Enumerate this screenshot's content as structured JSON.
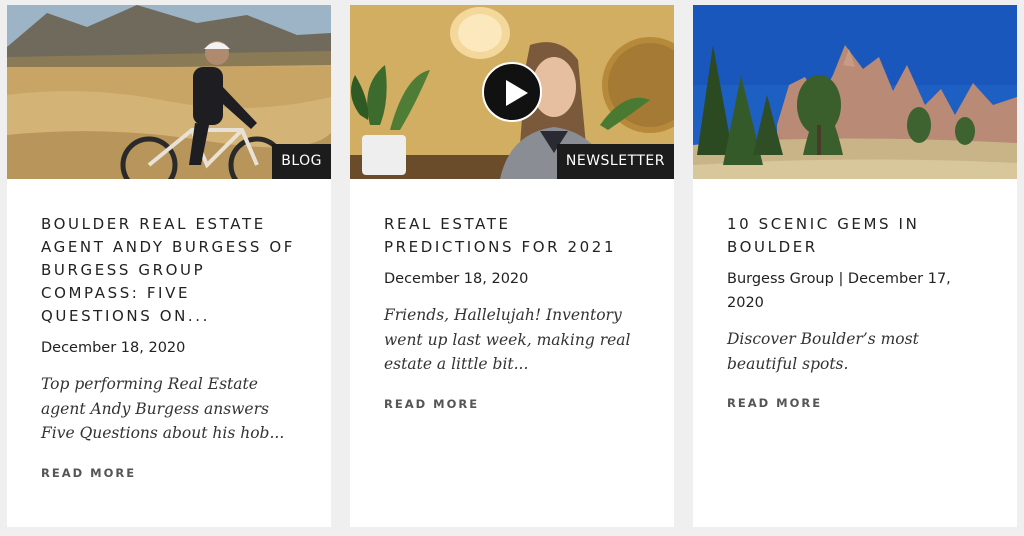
{
  "posts": [
    {
      "category": "BLOG",
      "title": "BOULDER REAL ESTATE AGENT ANDY BURGESS OF BURGESS GROUP COMPASS: FIVE QUESTIONS ON...",
      "meta": "December 18, 2020",
      "excerpt": "Top performing Real Estate agent Andy Burgess answers Five Questions about his hob...",
      "read_more": "READ MORE",
      "image": "cyclist-in-grassland-photo"
    },
    {
      "category": "NEWSLETTER",
      "title": "REAL ESTATE PREDICTIONS FOR 2021",
      "meta": "December 18, 2020",
      "excerpt": "Friends, Hallelujah! Inventory went up last week, making real estate a little bit...",
      "read_more": "READ MORE",
      "image": "woman-video-thumbnail",
      "play_label": "VIDEO"
    },
    {
      "category": "",
      "title": "10 SCENIC GEMS IN BOULDER",
      "meta": "Burgess Group | December 17, 2020",
      "excerpt": "Discover Boulder’s most beautiful spots.",
      "read_more": "READ MORE",
      "image": "flatirons-rocks-photo"
    }
  ],
  "colors": {
    "page_bg": "#efefef",
    "card_bg": "#ffffff",
    "tag_bg": "#1c1c1c"
  }
}
